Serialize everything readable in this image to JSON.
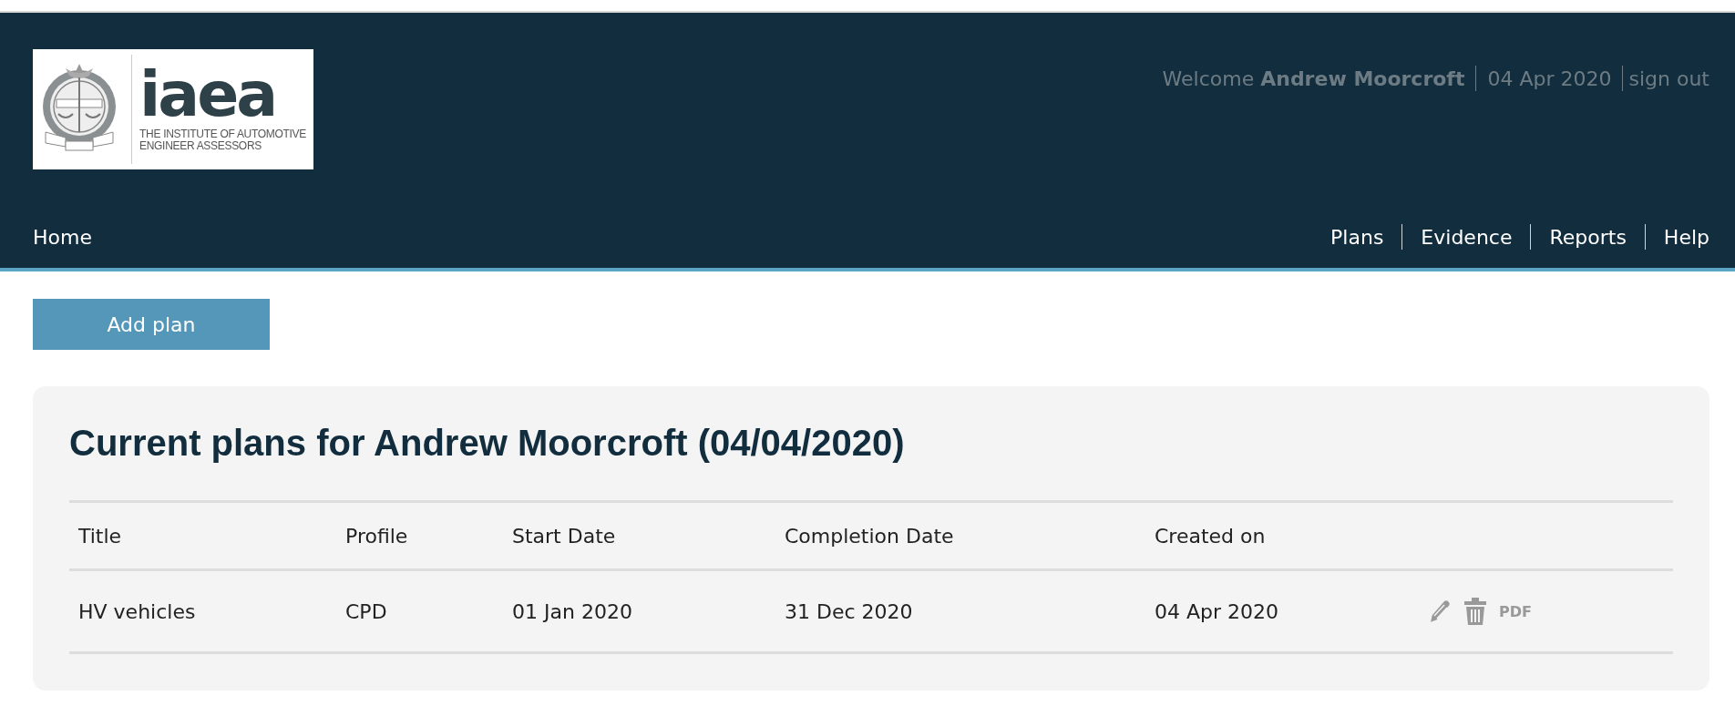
{
  "header": {
    "logo": {
      "wordmark": "iaea",
      "tagline_lines": [
        "THE INSTITUTE OF AUTOMOTIVE",
        "ENGINEER ASSESSORS"
      ]
    },
    "user_bar": {
      "welcome": "Welcome **Andrew Moorcroft**",
      "date": "04 Apr 2020",
      "sign_out": "sign out"
    },
    "nav_left": [
      "Home"
    ],
    "nav_right": [
      "Plans",
      "Evidence",
      "Reports",
      "Help"
    ]
  },
  "add_button": "Add plan",
  "card": {
    "title": "Current plans for Andrew Moorcroft (04/04/2020)",
    "table": {
      "columns": [
        "Title",
        "Profile",
        "Start Date",
        "Completion Date",
        "Created on"
      ],
      "rows": [
        {
          "cells": [
            "HV vehicles",
            "CPD",
            "01 Jan 2020",
            "31 Dec 2020",
            "04 Apr 2020"
          ],
          "actions": [
            {
              "kind": "edit"
            },
            {
              "kind": "delete"
            },
            {
              "kind": "pdf",
              "label": "PDF"
            }
          ]
        }
      ]
    }
  }
}
